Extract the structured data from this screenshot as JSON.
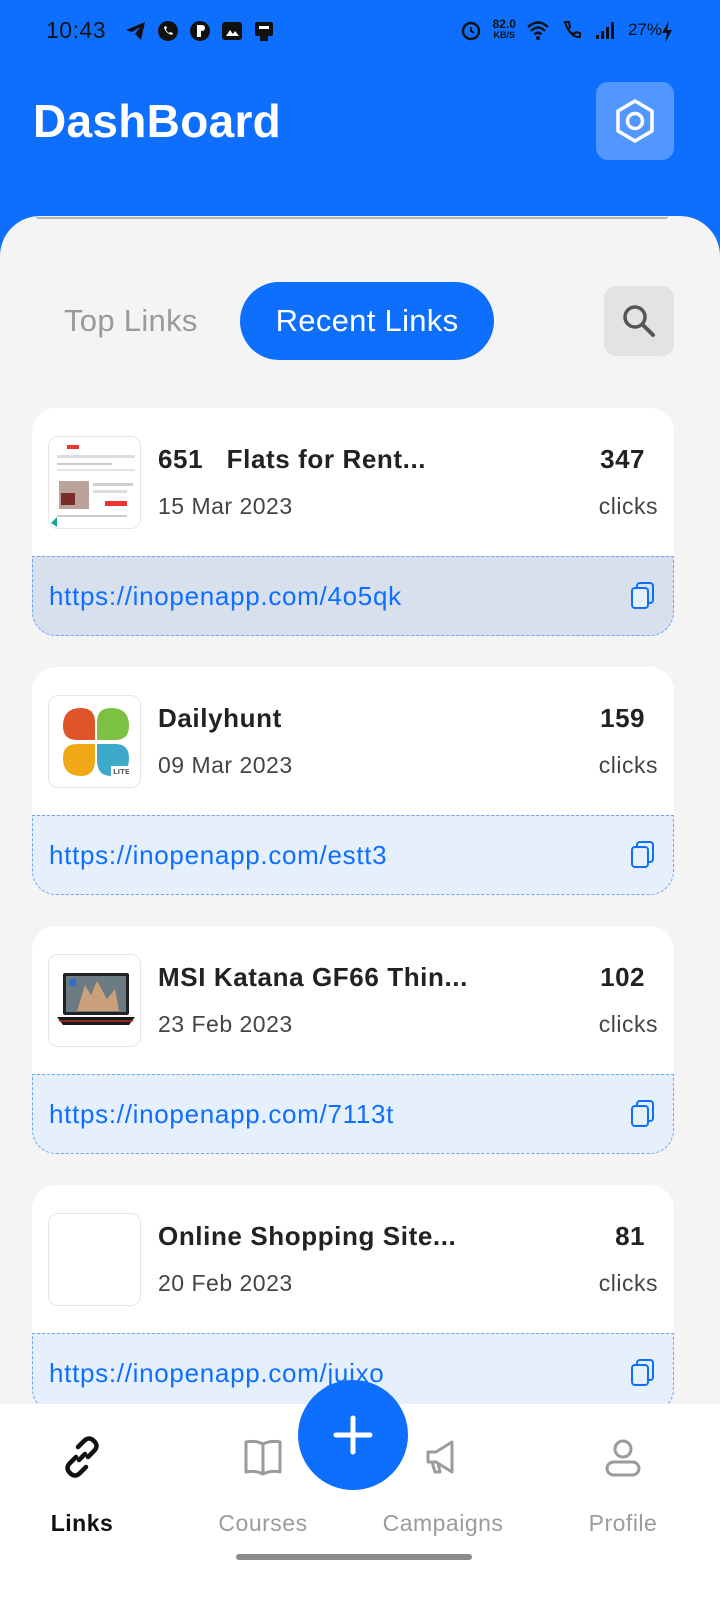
{
  "status_bar": {
    "time": "10:43",
    "net_speed_value": "82.0",
    "net_speed_unit": "KB/S",
    "battery": "27%"
  },
  "header": {
    "title": "DashBoard"
  },
  "tabs": {
    "top": "Top Links",
    "recent": "Recent Links",
    "active": "recent"
  },
  "links": [
    {
      "title": "651   Flats for Rent...",
      "date": "15 Mar 2023",
      "clicks": "347",
      "unit": "clicks",
      "url": "https://inopenapp.com/4o5qk"
    },
    {
      "title": "Dailyhunt",
      "date": "09 Mar 2023",
      "clicks": "159",
      "unit": "clicks",
      "url": "https://inopenapp.com/estt3"
    },
    {
      "title": "MSI Katana GF66 Thin...",
      "date": "23 Feb 2023",
      "clicks": "102",
      "unit": "clicks",
      "url": "https://inopenapp.com/7113t"
    },
    {
      "title": "Online Shopping Site...",
      "date": "20 Feb 2023",
      "clicks": "81",
      "unit": "clicks",
      "url": "https://inopenapp.com/juixo"
    }
  ],
  "nav": {
    "links": "Links",
    "courses": "Courses",
    "campaigns": "Campaigns",
    "profile": "Profile",
    "active": "links"
  },
  "colors": {
    "brand": "#0E6FFF",
    "sheet": "#F4F4F5"
  }
}
